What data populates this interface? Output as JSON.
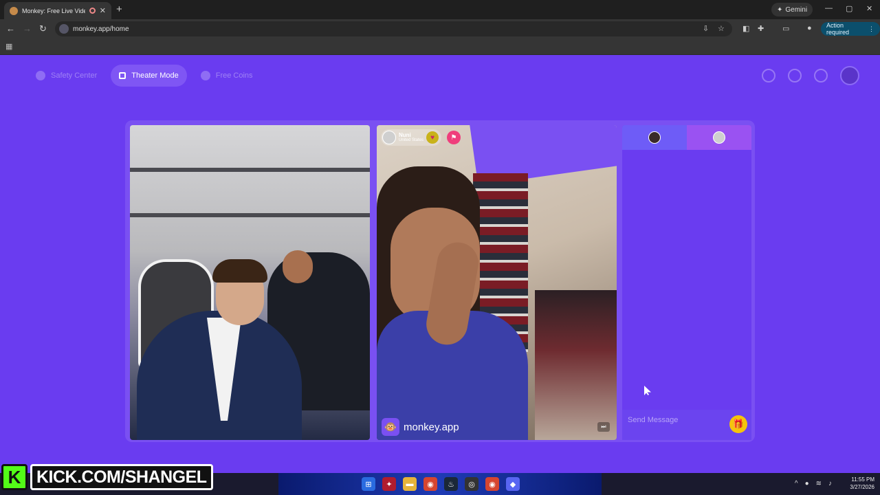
{
  "browser": {
    "tab_title": "Monkey: Free Live Video Ch",
    "new_tab": "+",
    "gemini_label": "Gemini",
    "url": "monkey.app/home",
    "action_required": "Action required"
  },
  "nav": {
    "safety_center": "Safety Center",
    "theater_mode": "Theater Mode",
    "free_coins": "Free Coins"
  },
  "match": {
    "name": "Nuni",
    "country": "United States"
  },
  "watermark": "monkey.app",
  "chat": {
    "placeholder": "Send Message"
  },
  "overlay": {
    "kick_text": "KICK.COM/SHANGEL"
  },
  "taskbar": {
    "time": "11:55 PM",
    "date": "3/27/2026"
  },
  "colors": {
    "page_bg": "#6a3cf0",
    "accent": "#7f56f4",
    "gift": "#f5c40d",
    "kick": "#53fc18"
  }
}
